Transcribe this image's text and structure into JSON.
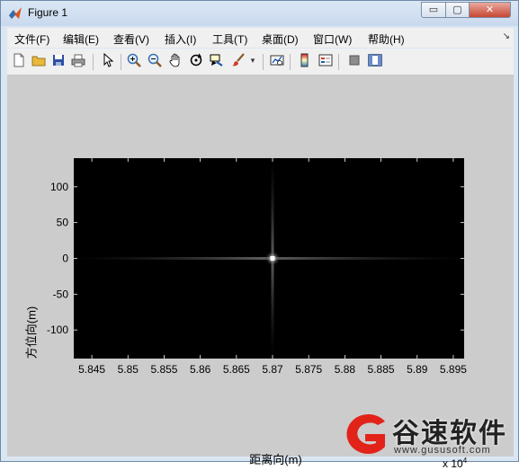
{
  "window": {
    "title": "Figure 1",
    "controls": {
      "minimize": "▭",
      "maximize": "▢",
      "close": "✕"
    }
  },
  "menubar": {
    "items": [
      "文件(F)",
      "编辑(E)",
      "查看(V)",
      "插入(I)",
      "工具(T)",
      "桌面(D)",
      "窗口(W)",
      "帮助(H)"
    ]
  },
  "toolbar": {
    "buttons": [
      {
        "name": "new-figure",
        "icon": "new-file-icon"
      },
      {
        "name": "open-file",
        "icon": "folder-open-icon"
      },
      {
        "name": "save-figure",
        "icon": "save-icon"
      },
      {
        "name": "print-figure",
        "icon": "printer-icon"
      },
      {
        "name": "edit-plot",
        "icon": "arrow-pointer-icon"
      },
      {
        "name": "zoom-in",
        "icon": "zoom-in-icon"
      },
      {
        "name": "zoom-out",
        "icon": "zoom-out-icon"
      },
      {
        "name": "pan",
        "icon": "hand-icon"
      },
      {
        "name": "rotate-3d",
        "icon": "rotate-icon"
      },
      {
        "name": "data-cursor",
        "icon": "data-cursor-icon"
      },
      {
        "name": "brush",
        "icon": "brush-icon"
      },
      {
        "name": "link-plot",
        "icon": "link-plot-icon"
      },
      {
        "name": "insert-colorbar",
        "icon": "colorbar-icon"
      },
      {
        "name": "insert-legend",
        "icon": "legend-icon"
      },
      {
        "name": "hide-plot-tools",
        "icon": "hide-tools-icon"
      },
      {
        "name": "show-plot-tools",
        "icon": "show-tools-icon"
      }
    ]
  },
  "chart_data": {
    "type": "heatmap",
    "title": "",
    "xlabel": "距离向(m)",
    "ylabel": "方位向(m)",
    "x_exponent_label": "x 10",
    "x_exponent": "4",
    "xlim": [
      5.8425,
      5.8965
    ],
    "ylim": [
      -140,
      140
    ],
    "xticks": [
      5.845,
      5.85,
      5.855,
      5.86,
      5.865,
      5.87,
      5.875,
      5.88,
      5.885,
      5.89,
      5.895
    ],
    "xtick_labels": [
      "5.845",
      "5.85",
      "5.855",
      "5.86",
      "5.865",
      "5.87",
      "5.875",
      "5.88",
      "5.885",
      "5.89",
      "5.895"
    ],
    "yticks": [
      100,
      50,
      0,
      -50,
      -100
    ],
    "ytick_labels": [
      "100",
      "50",
      "0",
      "-50",
      "-100"
    ],
    "colormap": "gray",
    "background_color": "#000000",
    "point_target": {
      "x": 5.87,
      "y": 0
    },
    "grid": false
  },
  "watermark": {
    "text": "谷速软件",
    "url": "www.gususoft.com",
    "accent_color": "#e2231a"
  }
}
